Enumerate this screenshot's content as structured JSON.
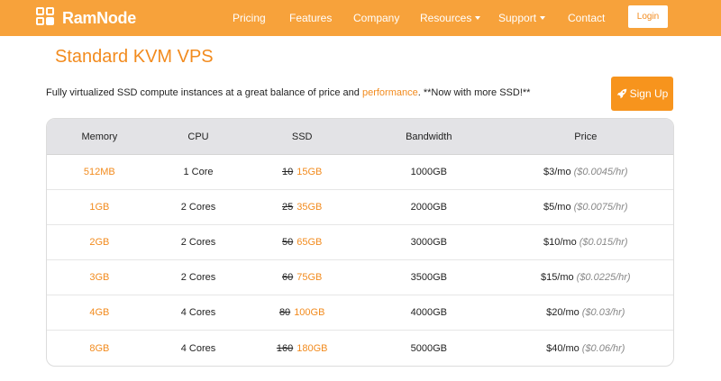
{
  "brand": {
    "name": "RamNode",
    "accent": "#f7a23b",
    "highlight": "#f28b1e"
  },
  "nav": {
    "items": [
      {
        "label": "Pricing",
        "dropdown": false
      },
      {
        "label": "Features",
        "dropdown": false
      },
      {
        "label": "Company",
        "dropdown": false
      },
      {
        "label": "Resources",
        "dropdown": true
      },
      {
        "label": "Support",
        "dropdown": true
      },
      {
        "label": "Contact",
        "dropdown": false
      }
    ],
    "login_label": "Login"
  },
  "page": {
    "title": "Standard KVM VPS",
    "description_before": "Fully virtualized SSD compute instances at a great balance of price and ",
    "description_link": "performance",
    "description_after": ". **Now with more SSD!**",
    "signup_label": "Sign Up",
    "signup_icon": "rocket-icon"
  },
  "table": {
    "headers": [
      "Memory",
      "CPU",
      "SSD",
      "Bandwidth",
      "Price"
    ],
    "rows": [
      {
        "memory": "512MB",
        "cpu": "1 Core",
        "ssd_old": "10",
        "ssd_new": "15GB",
        "bandwidth": "1000GB",
        "price": "$3/mo",
        "hourly": "($0.0045/hr)"
      },
      {
        "memory": "1GB",
        "cpu": "2 Cores",
        "ssd_old": "25",
        "ssd_new": "35GB",
        "bandwidth": "2000GB",
        "price": "$5/mo",
        "hourly": "($0.0075/hr)"
      },
      {
        "memory": "2GB",
        "cpu": "2 Cores",
        "ssd_old": "50",
        "ssd_new": "65GB",
        "bandwidth": "3000GB",
        "price": "$10/mo",
        "hourly": "($0.015/hr)"
      },
      {
        "memory": "3GB",
        "cpu": "2 Cores",
        "ssd_old": "60",
        "ssd_new": "75GB",
        "bandwidth": "3500GB",
        "price": "$15/mo",
        "hourly": "($0.0225/hr)"
      },
      {
        "memory": "4GB",
        "cpu": "4 Cores",
        "ssd_old": "80",
        "ssd_new": "100GB",
        "bandwidth": "4000GB",
        "price": "$20/mo",
        "hourly": "($0.03/hr)"
      },
      {
        "memory": "8GB",
        "cpu": "4 Cores",
        "ssd_old": "160",
        "ssd_new": "180GB",
        "bandwidth": "5000GB",
        "price": "$40/mo",
        "hourly": "($0.06/hr)"
      }
    ]
  }
}
